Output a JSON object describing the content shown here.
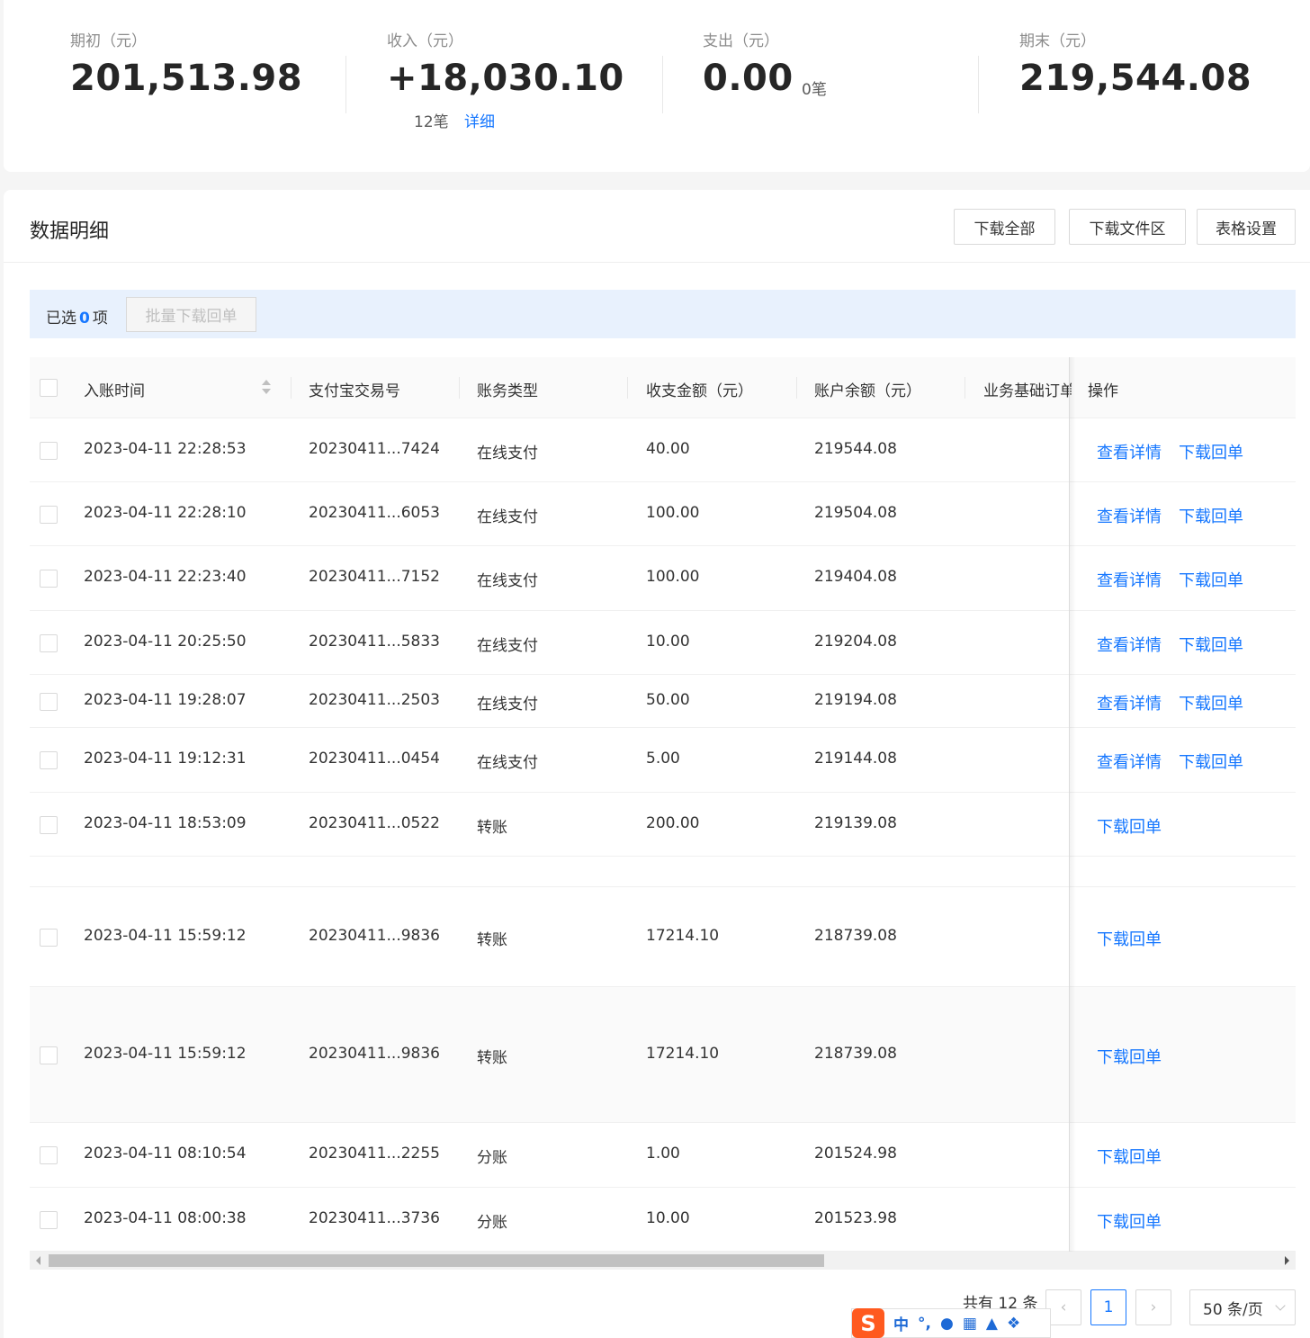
{
  "summary": {
    "opening": {
      "label": "期初（元）",
      "value": "201,513.98"
    },
    "income": {
      "label": "收入（元）",
      "value": "+18,030.10",
      "count": "12笔",
      "link": "详细"
    },
    "expense": {
      "label": "支出（元）",
      "value": "0.00",
      "count": "0笔"
    },
    "closing": {
      "label": "期末（元）",
      "value": "219,544.08"
    }
  },
  "detail": {
    "title": "数据明细",
    "buttons": {
      "download_all": "下载全部",
      "download_area": "下载文件区",
      "table_settings": "表格设置"
    },
    "selection": {
      "prefix": "已选",
      "count": "0",
      "suffix": "项",
      "batch": "批量下载回单"
    }
  },
  "table": {
    "columns": [
      "入账时间",
      "支付宝交易号",
      "账务类型",
      "收支金额（元）",
      "账户余额（元）",
      "业务基础订单",
      "操作"
    ],
    "rows": [
      {
        "time": "2023-04-11 22:28:53",
        "txn": "20230411...7424",
        "type": "在线支付",
        "amount": "40.00",
        "balance": "219544.08",
        "actions": [
          "查看详情",
          "下载回单"
        ]
      },
      {
        "time": "2023-04-11 22:28:10",
        "txn": "20230411...6053",
        "type": "在线支付",
        "amount": "100.00",
        "balance": "219504.08",
        "actions": [
          "查看详情",
          "下载回单"
        ]
      },
      {
        "time": "2023-04-11 22:23:40",
        "txn": "20230411...7152",
        "type": "在线支付",
        "amount": "100.00",
        "balance": "219404.08",
        "actions": [
          "查看详情",
          "下载回单"
        ]
      },
      {
        "time": "2023-04-11 20:25:50",
        "txn": "20230411...5833",
        "type": "在线支付",
        "amount": "10.00",
        "balance": "219204.08",
        "actions": [
          "查看详情",
          "下载回单"
        ]
      },
      {
        "time": "2023-04-11 19:28:07",
        "txn": "20230411...2503",
        "type": "在线支付",
        "amount": "50.00",
        "balance": "219194.08",
        "actions": [
          "查看详情",
          "下载回单"
        ]
      },
      {
        "time": "2023-04-11 19:12:31",
        "txn": "20230411...0454",
        "type": "在线支付",
        "amount": "5.00",
        "balance": "219144.08",
        "actions": [
          "查看详情",
          "下载回单"
        ]
      },
      {
        "time": "2023-04-11 18:53:09",
        "txn": "20230411...0522",
        "type": "转账",
        "amount": "200.00",
        "balance": "219139.08",
        "actions": [
          "下载回单"
        ]
      },
      {
        "time": "2023-04-11 15:59:12",
        "txn": "20230411...9836",
        "type": "转账",
        "amount": "17214.10",
        "balance": "218739.08",
        "actions": [
          "下载回单"
        ]
      },
      {
        "time": "2023-04-11 15:59:12",
        "txn": "20230411...9836",
        "type": "转账",
        "amount": "17214.10",
        "balance": "218739.08",
        "actions": [
          "下载回单"
        ]
      },
      {
        "time": "2023-04-11 08:10:54",
        "txn": "20230411...2255",
        "type": "分账",
        "amount": "1.00",
        "balance": "201524.98",
        "actions": [
          "下载回单"
        ]
      },
      {
        "time": "2023-04-11 08:00:38",
        "txn": "20230411...3736",
        "type": "分账",
        "amount": "10.00",
        "balance": "201523.98",
        "actions": [
          "下载回单"
        ]
      }
    ]
  },
  "pagination": {
    "total": "共有 12 条",
    "current": "1",
    "page_size": "50 条/页"
  },
  "ime": {
    "logo": "S",
    "mode": "中",
    "punct": "°,"
  },
  "colors": {
    "accent": "#1677ff",
    "selection_bar": "#e8f1fd"
  }
}
